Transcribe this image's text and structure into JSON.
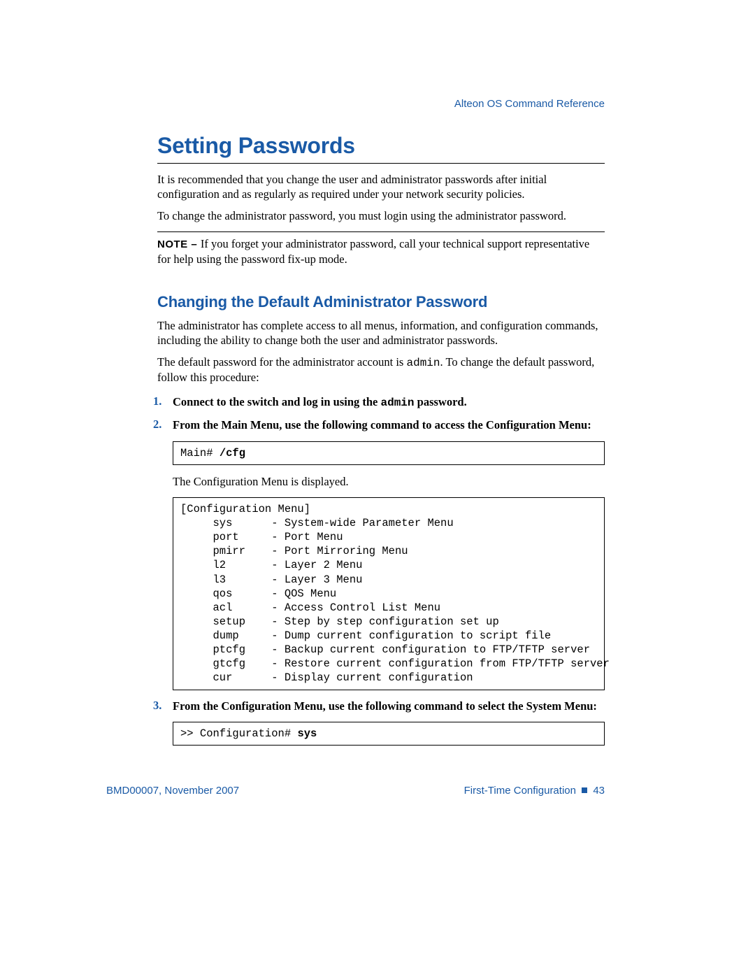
{
  "header": {
    "doc_title": "Alteon OS  Command Reference"
  },
  "section": {
    "title": "Setting Passwords",
    "intro_p1": "It is recommended that you change the user and administrator passwords after initial configuration and as regularly as required under your network security policies.",
    "intro_p2": "To change the administrator password, you must login using the administrator password.",
    "note_label": "NOTE – ",
    "note_text": "If you forget your administrator password, call your technical support representative for help using the password fix-up mode.",
    "subheading": "Changing the Default Administrator Password",
    "sub_p1": "The administrator has complete access to all menus, information, and configuration commands, including the ability to change both the user and administrator passwords.",
    "sub_p2_a": "The default password for the administrator account is ",
    "sub_p2_code": "admin",
    "sub_p2_b": ". To change the default password, follow this procedure:"
  },
  "steps": {
    "s1_a": "Connect to the switch and log in using the ",
    "s1_code": "admin",
    "s1_b": " password.",
    "s2": "From the Main Menu, use the following command to access the Configuration Menu:",
    "s2_code_prompt": "Main# ",
    "s2_code_cmd": "/cfg",
    "s2_after": "The Configuration Menu is displayed.",
    "s2_menu": "[Configuration Menu]\n     sys      - System-wide Parameter Menu\n     port     - Port Menu\n     pmirr    - Port Mirroring Menu\n     l2       - Layer 2 Menu\n     l3       - Layer 3 Menu\n     qos      - QOS Menu\n     acl      - Access Control List Menu\n     setup    - Step by step configuration set up\n     dump     - Dump current configuration to script file\n     ptcfg    - Backup current configuration to FTP/TFTP server\n     gtcfg    - Restore current configuration from FTP/TFTP server\n     cur      - Display current configuration",
    "s3": "From the Configuration Menu, use the following command to select the System Menu:",
    "s3_code_prompt": ">> Configuration# ",
    "s3_code_cmd": "sys"
  },
  "footer": {
    "left": "BMD00007, November 2007",
    "right_label": "First-Time Configuration",
    "page_num": "43"
  }
}
